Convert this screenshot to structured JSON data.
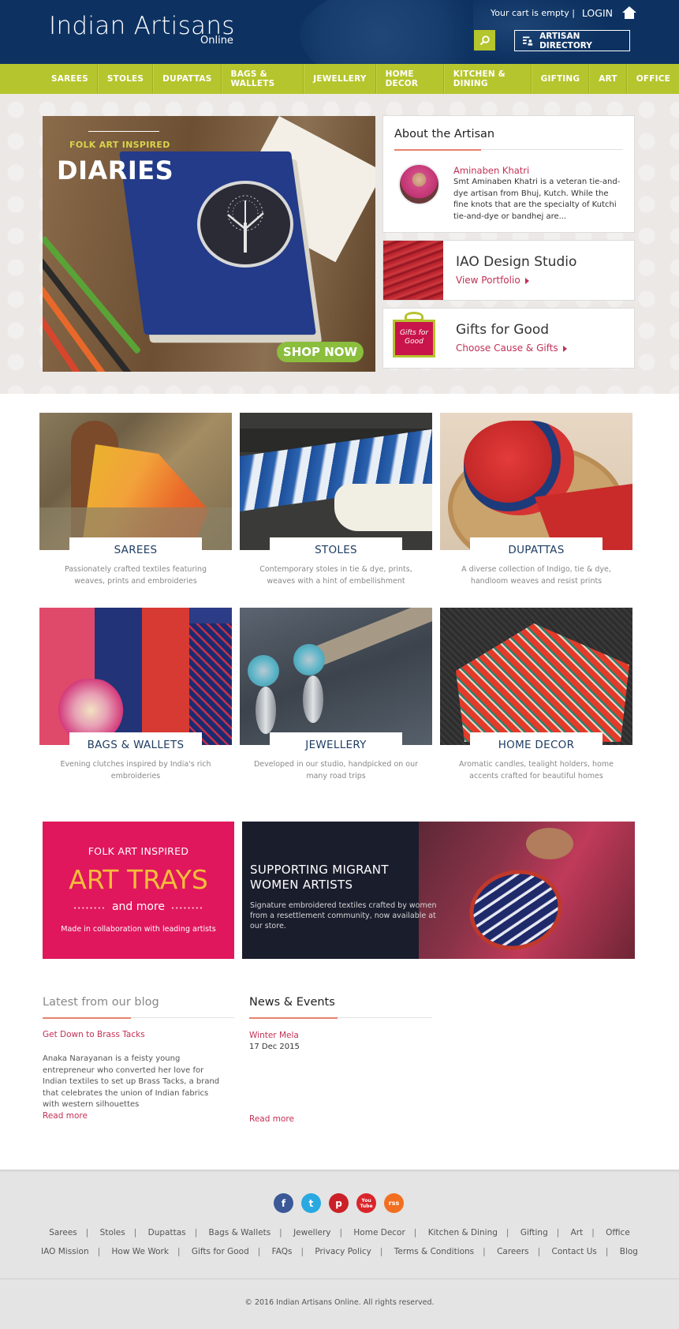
{
  "header": {
    "logo_main": "Indian Artisans",
    "logo_sub": "Online",
    "cart_text": "Your cart is empty |",
    "login_label": "LOGIN",
    "home_icon": "home-icon",
    "search_icon": "search-icon",
    "directory_label": "ARTISAN DIRECTORY",
    "colors": {
      "header_bg": "#0d3262",
      "accent": "#b5c52d"
    }
  },
  "nav": {
    "items": [
      {
        "label": "SAREES"
      },
      {
        "label": "STOLES"
      },
      {
        "label": "DUPATTAS"
      },
      {
        "label": "BAGS & WALLETS"
      },
      {
        "label": "JEWELLERY"
      },
      {
        "label": "HOME DECOR"
      },
      {
        "label": "KITCHEN & DINING"
      },
      {
        "label": "GIFTING"
      },
      {
        "label": "ART"
      },
      {
        "label": "OFFICE"
      }
    ]
  },
  "banner": {
    "kicker": "FOLK ART INSPIRED",
    "headline": "DIARIES",
    "cta": "SHOP NOW"
  },
  "about": {
    "title": "About the Artisan",
    "name": "Aminaben Khatri",
    "bio": "Smt Aminaben Khatri is a veteran tie-and-dye artisan from Bhuj, Kutch. While the fine knots that are the specialty of Kutchi tie-and-dye or bandhej are..."
  },
  "studio": {
    "title": "IAO Design Studio",
    "link": "View Portfolio"
  },
  "gifts": {
    "title": "Gifts for Good",
    "link": "Choose Cause & Gifts",
    "box_text": "Gifts for Good"
  },
  "categories": [
    {
      "name": "SAREES",
      "desc": "Passionately crafted textiles featuring weaves, prints and embroideries"
    },
    {
      "name": "STOLES",
      "desc": "Contemporary stoles in tie & dye, prints, weaves with a hint of embellishment"
    },
    {
      "name": "DUPATTAS",
      "desc": "A diverse collection of Indigo, tie & dye, handloom weaves and resist prints"
    },
    {
      "name": "BAGS & WALLETS",
      "desc": "Evening clutches inspired by India's rich embroideries"
    },
    {
      "name": "JEWELLERY",
      "desc": "Developed in our studio, handpicked on our many road trips"
    },
    {
      "name": "HOME DECOR",
      "desc": "Aromatic candles, tealight holders, home accents crafted for beautiful homes"
    }
  ],
  "promo_trays": {
    "kicker": "FOLK ART INSPIRED",
    "headline": "ART TRAYS",
    "sub": "and more",
    "note": "Made in collaboration with leading artists"
  },
  "promo_migrant": {
    "headline": "SUPPORTING MIGRANT WOMEN ARTISTS",
    "text": "Signature embroidered textiles crafted by women from a resettlement community, now available at our store."
  },
  "blog": {
    "heading": "Latest from our blog",
    "post_title": "Get Down to Brass Tacks",
    "post_text": "Anaka Narayanan is a feisty young entrepreneur who converted her love for Indian textiles to set up Brass Tacks, a brand that celebrates the union of Indian fabrics with western silhouettes",
    "read_more": "Read more"
  },
  "news": {
    "heading": "News & Events",
    "event_title": "Winter Mela",
    "event_date": "17 Dec 2015",
    "read_more": "Read more"
  },
  "footer": {
    "social": [
      "facebook-icon",
      "twitter-icon",
      "pinterest-icon",
      "youtube-icon",
      "rss-icon"
    ],
    "social_labels": [
      "f",
      "t",
      "p",
      "You Tube",
      "rss"
    ],
    "links_row1": [
      "Sarees",
      "Stoles",
      "Dupattas",
      "Bags & Wallets",
      "Jewellery",
      "Home Decor",
      "Kitchen & Dining",
      "Gifting",
      "Art",
      "Office"
    ],
    "links_row2": [
      "IAO Mission",
      "How We Work",
      "Gifts for Good",
      "FAQs",
      "Privacy Policy",
      "Terms & Conditions",
      "Careers",
      "Contact Us",
      "Blog"
    ],
    "copyright": "© 2016 Indian Artisans Online. All rights reserved."
  }
}
